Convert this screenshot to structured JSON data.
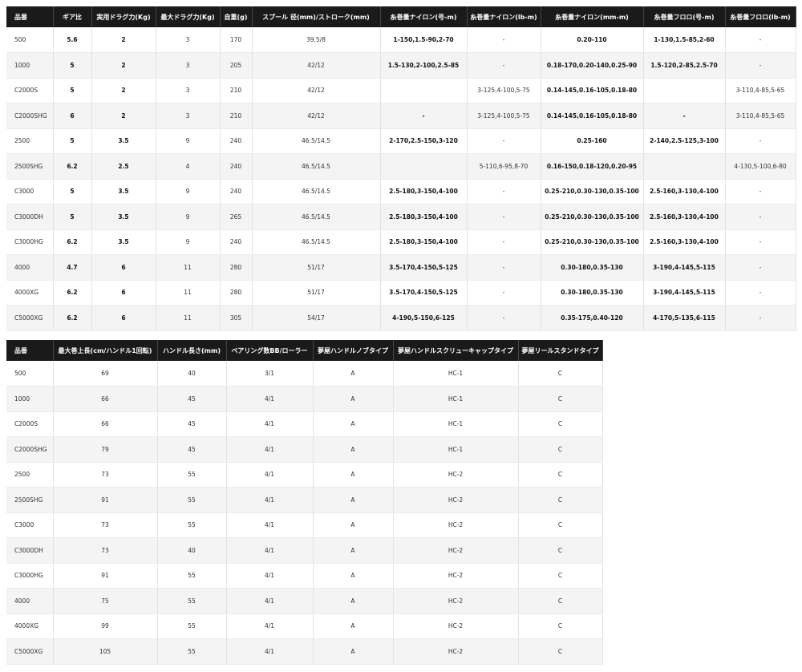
{
  "table1": {
    "headers": [
      "品番",
      "ギア比",
      "実用ドラグ力(Kg)",
      "最大ドラグ力(Kg)",
      "自重(g)",
      "スプール 径(mm)/ストローク(mm)",
      "糸巻量ナイロン(号-m)",
      "糸巻量ナイロン(lb-m)",
      "糸巻量ナイロン(mm-m)",
      "糸巻量フロロ(号-m)",
      "糸巻量フロロ(lb-m)"
    ],
    "rows": [
      [
        "500",
        "5.6",
        "2",
        "3",
        "170",
        "39.5/8",
        "1-150,1.5-90,2-70",
        "-",
        "0.20-110",
        "1-130,1.5-85,2-60",
        "-"
      ],
      [
        "1000",
        "5",
        "2",
        "3",
        "205",
        "42/12",
        "1.5-130,2-100,2.5-85",
        "-",
        "0.18-170,0.20-140,0.25-90",
        "1.5-120,2-85,2.5-70",
        "-"
      ],
      [
        "C2000S",
        "5",
        "2",
        "3",
        "210",
        "42/12",
        "",
        "3-125,4-100,5-75",
        "0.14-145,0.16-105,0.18-80",
        "",
        "3-110,4-85,5-65"
      ],
      [
        "C2000SHG",
        "6",
        "2",
        "3",
        "210",
        "42/12",
        "-",
        "3-125,4-100,5-75",
        "0.14-145,0.16-105,0.18-80",
        "-",
        "3-110,4-85,5-65"
      ],
      [
        "2500",
        "5",
        "3.5",
        "9",
        "240",
        "46.5/14.5",
        "2-170,2.5-150,3-120",
        "-",
        "0.25-160",
        "2-140,2.5-125,3-100",
        "-"
      ],
      [
        "2500SHG",
        "6.2",
        "2.5",
        "4",
        "240",
        "46.5/14.5",
        "",
        "5-110,6-95,8-70",
        "0.16-150,0.18-120,0.20-95",
        "",
        "4-130,5-100,6-80"
      ],
      [
        "C3000",
        "5",
        "3.5",
        "9",
        "240",
        "46.5/14.5",
        "2.5-180,3-150,4-100",
        "-",
        "0.25-210,0.30-130,0.35-100",
        "2.5-160,3-130,4-100",
        "-"
      ],
      [
        "C3000DH",
        "5",
        "3.5",
        "9",
        "265",
        "46.5/14.5",
        "2.5-180,3-150,4-100",
        "-",
        "0.25-210,0.30-130,0.35-100",
        "2.5-160,3-130,4-100",
        "-"
      ],
      [
        "C3000HG",
        "6.2",
        "3.5",
        "9",
        "240",
        "46.5/14.5",
        "2.5-180,3-150,4-100",
        "-",
        "0.25-210,0.30-130,0.35-100",
        "2.5-160,3-130,4-100",
        "-"
      ],
      [
        "4000",
        "4.7",
        "6",
        "11",
        "280",
        "51/17",
        "3.5-170,4-150,5-125",
        "-",
        "0.30-180,0.35-130",
        "3-190,4-145,5-115",
        "-"
      ],
      [
        "4000XG",
        "6.2",
        "6",
        "11",
        "280",
        "51/17",
        "3.5-170,4-150,5-125",
        "-",
        "0.30-180,0.35-130",
        "3-190,4-145,5-115",
        "-"
      ],
      [
        "C5000XG",
        "6.2",
        "6",
        "11",
        "305",
        "54/17",
        "4-190,5-150,6-125",
        "-",
        "0.35-175,0.40-120",
        "4-170,5-135,6-115",
        "-"
      ]
    ]
  },
  "table2": {
    "headers": [
      "品番",
      "最大巻上長(cm/ハンドル1回転)",
      "ハンドル長さ(mm)",
      "ベアリング数BB/ローラー",
      "夢屋ハンドルノブタイプ",
      "夢屋ハンドルスクリューキャップタイプ",
      "夢屋リールスタンドタイプ"
    ],
    "rows": [
      [
        "500",
        "69",
        "40",
        "3/1",
        "A",
        "HC-1",
        "C"
      ],
      [
        "1000",
        "66",
        "45",
        "4/1",
        "A",
        "HC-1",
        "C"
      ],
      [
        "C2000S",
        "66",
        "45",
        "4/1",
        "A",
        "HC-1",
        "C"
      ],
      [
        "C2000SHG",
        "79",
        "45",
        "4/1",
        "A",
        "HC-1",
        "C"
      ],
      [
        "2500",
        "73",
        "55",
        "4/1",
        "A",
        "HC-2",
        "C"
      ],
      [
        "2500SHG",
        "91",
        "55",
        "4/1",
        "A",
        "HC-2",
        "C"
      ],
      [
        "C3000",
        "73",
        "55",
        "4/1",
        "A",
        "HC-2",
        "C"
      ],
      [
        "C3000DH",
        "73",
        "40",
        "4/1",
        "A",
        "HC-2",
        "C"
      ],
      [
        "C3000HG",
        "91",
        "55",
        "4/1",
        "A",
        "HC-2",
        "C"
      ],
      [
        "4000",
        "75",
        "55",
        "4/1",
        "A",
        "HC-2",
        "C"
      ],
      [
        "4000XG",
        "99",
        "55",
        "4/1",
        "A",
        "HC-2",
        "C"
      ],
      [
        "C5000XG",
        "105",
        "55",
        "4/1",
        "A",
        "HC-2",
        "C"
      ]
    ]
  }
}
